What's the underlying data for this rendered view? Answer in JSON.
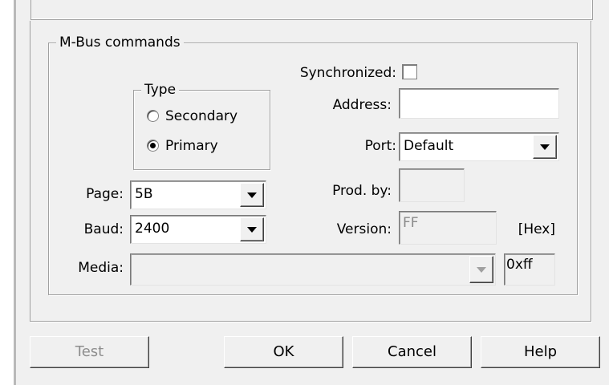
{
  "mbus": {
    "group_title": "M-Bus commands",
    "type": {
      "title": "Type",
      "options": [
        "Secondary",
        "Primary"
      ],
      "selected": "Primary"
    },
    "synchronized": {
      "label": "Synchronized:",
      "checked": false
    },
    "address": {
      "label": "Address:",
      "value": ""
    },
    "port": {
      "label": "Port:",
      "value": "Default"
    },
    "page": {
      "label": "Page:",
      "value": "5B"
    },
    "baud": {
      "label": "Baud:",
      "value": "2400"
    },
    "prod_by": {
      "label": "Prod. by:",
      "value": ""
    },
    "version": {
      "label": "Version:",
      "value": "FF",
      "unit": "[Hex]"
    },
    "media": {
      "label": "Media:",
      "value": "",
      "hex": "0xff"
    }
  },
  "buttons": {
    "test": "Test",
    "ok": "OK",
    "cancel": "Cancel",
    "help": "Help"
  }
}
